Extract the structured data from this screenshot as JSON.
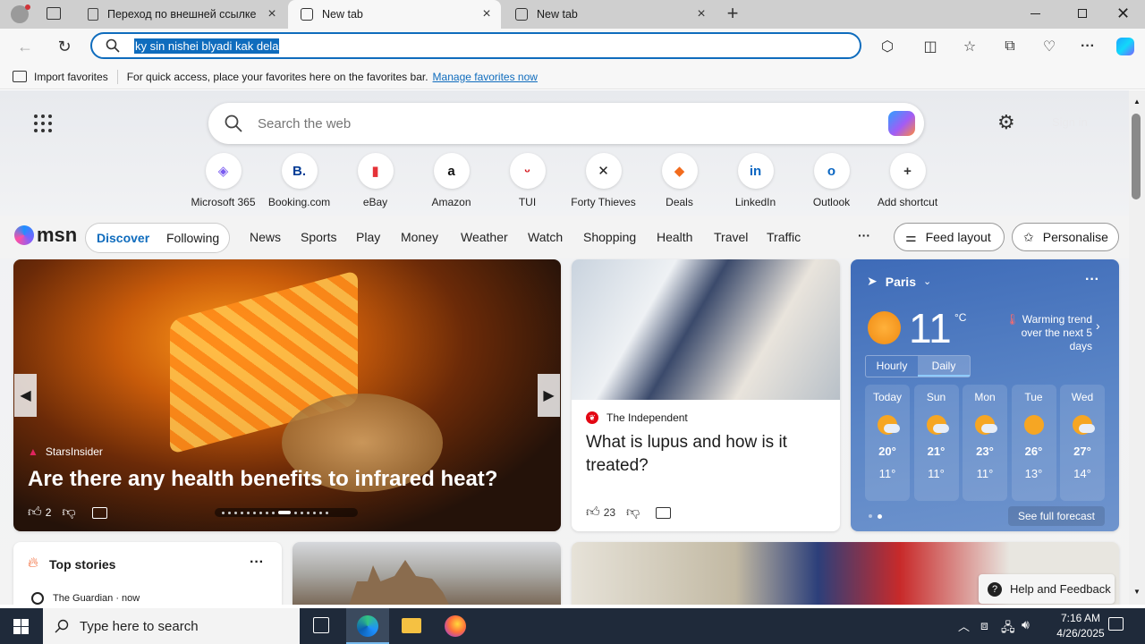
{
  "tabs": [
    {
      "title": "Переход по внешней ссылке",
      "active": false
    },
    {
      "title": "New tab",
      "active": true
    },
    {
      "title": "New tab",
      "active": false
    }
  ],
  "address": {
    "value": "ky sin nishei blyadi kak dela"
  },
  "favbar": {
    "import_label": "Import favorites",
    "hint": "For quick access, place your favorites here on the favorites bar.",
    "manage_link": "Manage favorites now"
  },
  "search": {
    "placeholder": "Search the web"
  },
  "signin": "Sign in",
  "shortcuts": [
    {
      "label": "Microsoft 365",
      "glyph": "◈",
      "color": "#7a5cf0"
    },
    {
      "label": "Booking.com",
      "glyph": "B.",
      "color": "#003b95"
    },
    {
      "label": "eBay",
      "glyph": "▮",
      "color": "#e53238"
    },
    {
      "label": "Amazon",
      "glyph": "a",
      "color": "#111111"
    },
    {
      "label": "TUI",
      "glyph": "ᵕ",
      "color": "#d40e14"
    },
    {
      "label": "Forty Thieves",
      "glyph": "✕",
      "color": "#222222"
    },
    {
      "label": "Deals",
      "glyph": "◆",
      "color": "#f26b1d"
    },
    {
      "label": "LinkedIn",
      "glyph": "in",
      "color": "#0a66c2"
    },
    {
      "label": "Outlook",
      "glyph": "o",
      "color": "#0a66c2"
    },
    {
      "label": "Add shortcut",
      "glyph": "+",
      "color": "#333333"
    }
  ],
  "msn": {
    "logo": "msn",
    "tabs": {
      "discover": "Discover",
      "following": "Following"
    },
    "nav": [
      "News",
      "Sports",
      "Play",
      "Money",
      "Weather",
      "Watch",
      "Shopping",
      "Health",
      "Travel",
      "Traffic"
    ],
    "more": "···",
    "feed_layout": "Feed layout",
    "personalise": "Personalise"
  },
  "hero": {
    "source": "StarsInsider",
    "title": "Are there any health benefits to infrared heat?",
    "likes": "2"
  },
  "article2": {
    "source": "The Independent",
    "title": "What is lupus and how is it treated?",
    "likes": "23"
  },
  "weather": {
    "city": "Paris",
    "temp": "11",
    "unit": "°C",
    "trend_line1": "Warming trend",
    "trend_line2": "over the next 5 days",
    "tab_hourly": "Hourly",
    "tab_daily": "Daily",
    "days": [
      {
        "name": "Today",
        "hi": "20°",
        "lo": "11°",
        "cloud": true
      },
      {
        "name": "Sun",
        "hi": "21°",
        "lo": "11°",
        "cloud": true
      },
      {
        "name": "Mon",
        "hi": "23°",
        "lo": "11°",
        "cloud": true
      },
      {
        "name": "Tue",
        "hi": "26°",
        "lo": "13°",
        "cloud": false
      },
      {
        "name": "Wed",
        "hi": "27°",
        "lo": "14°",
        "cloud": true
      }
    ],
    "see_full": "See full forecast"
  },
  "top_stories": {
    "title": "Top stories",
    "source": "The Guardian · now"
  },
  "help": "Help and Feedback",
  "taskbar": {
    "search_placeholder": "Type here to search",
    "time": "7:16 AM",
    "date": "4/26/2025"
  }
}
